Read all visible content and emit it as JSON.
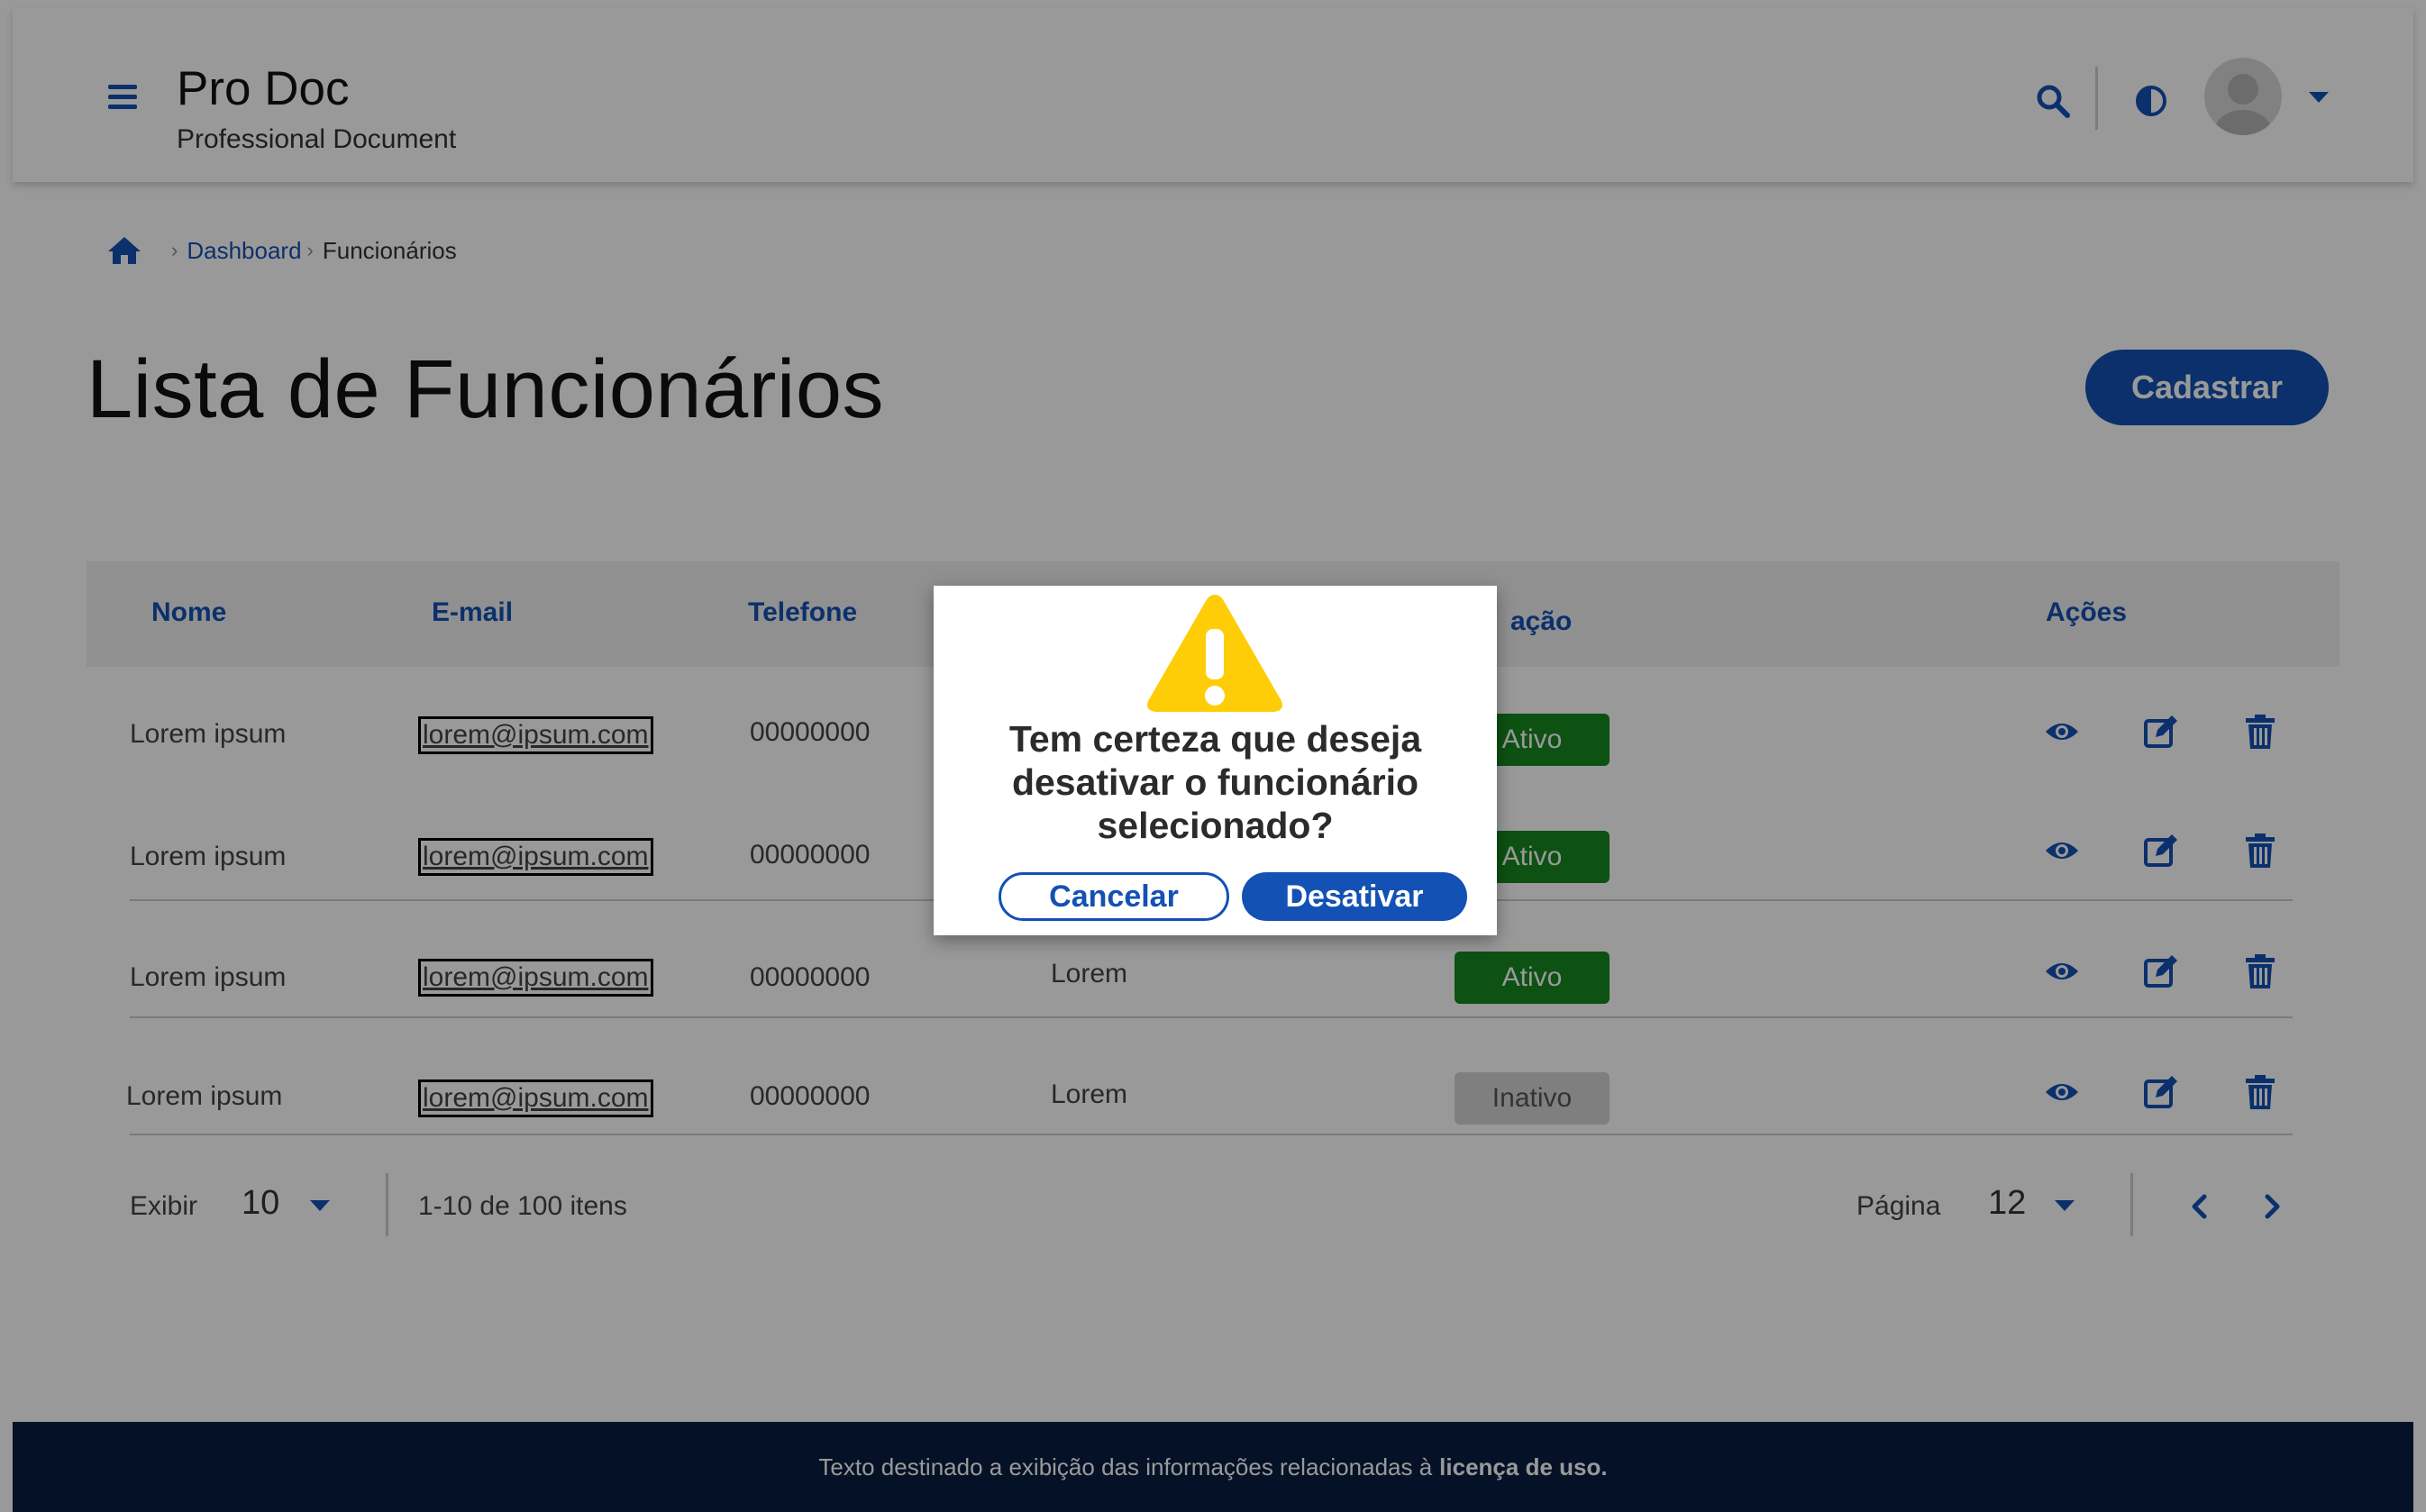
{
  "colors": {
    "primary": "#1351b4",
    "success": "#168821",
    "inactive": "#d4d4d4",
    "footer_bg": "#071d41",
    "warning": "#ffcd07"
  },
  "header": {
    "title": "Pro Doc",
    "subtitle": "Professional Document",
    "icons": [
      "menu-icon",
      "search-icon",
      "contrast-icon",
      "avatar",
      "chevron-down-icon"
    ]
  },
  "breadcrumb": {
    "home_icon": "home-icon",
    "items": [
      "Dashboard",
      "Funcionários"
    ]
  },
  "page": {
    "title": "Lista de Funcionários",
    "register_button": "Cadastrar"
  },
  "table": {
    "headers": [
      "Nome",
      "E-mail",
      "Telefone",
      "Situação",
      "Ações"
    ],
    "visible_situation_header": "ação",
    "rows": [
      {
        "nome": "Lorem ipsum",
        "email": "lorem@ipsum.com",
        "telefone": "00000000",
        "col4": "",
        "status": "Ativo"
      },
      {
        "nome": "Lorem ipsum",
        "email": "lorem@ipsum.com",
        "telefone": "00000000",
        "col4": "",
        "status": "Ativo"
      },
      {
        "nome": "Lorem ipsum",
        "email": "lorem@ipsum.com",
        "telefone": "00000000",
        "col4": "Lorem",
        "status": "Ativo"
      },
      {
        "nome": "Lorem ipsum",
        "email": "lorem@ipsum.com",
        "telefone": "00000000",
        "col4": "Lorem",
        "status": "Inativo"
      }
    ],
    "action_icons": [
      "eye-icon",
      "edit-icon",
      "trash-icon"
    ]
  },
  "pagination": {
    "show_label": "Exibir",
    "page_size": "10",
    "range_text": "1-10 de 100 itens",
    "page_label": "Página",
    "page_number": "12",
    "prev_icon": "chevron-left-icon",
    "next_icon": "chevron-right-icon"
  },
  "footer": {
    "text": "Texto destinado a exibição das informações relacionadas à",
    "bold": "licença de uso."
  },
  "modal": {
    "icon": "warning-icon",
    "message": "Tem certeza que deseja desativar o funcionário selecionado?",
    "cancel": "Cancelar",
    "confirm": "Desativar"
  }
}
